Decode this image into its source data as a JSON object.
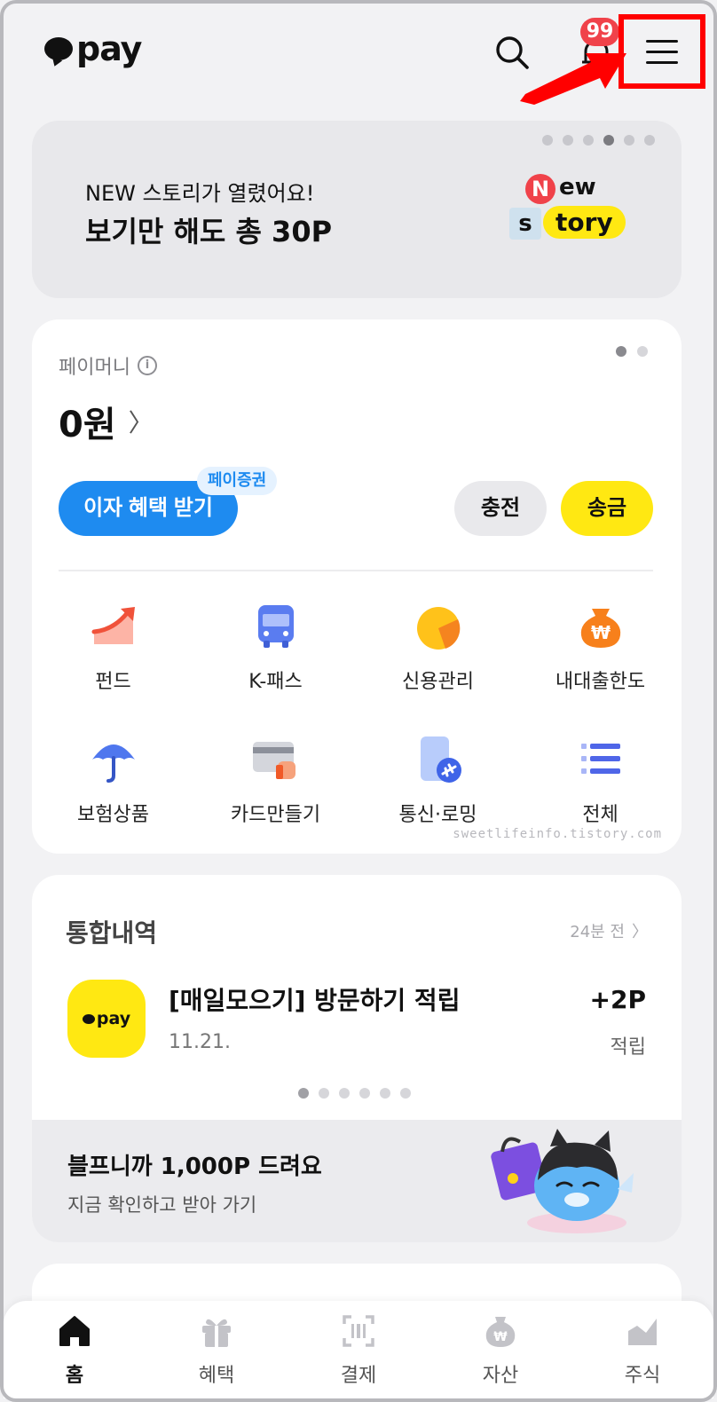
{
  "header": {
    "logo_text": "pay",
    "notification_count": "99"
  },
  "banner": {
    "subtitle": "NEW 스토리가 열렸어요!",
    "title": "보기만 해도 총 30P",
    "badge_n": "N",
    "badge_ew": "ew",
    "badge_s": "s",
    "badge_tory": "tory",
    "page_count": 6,
    "active_page": 4
  },
  "paymoney": {
    "label": "페이머니",
    "balance": "0원",
    "interest_button": "이자 혜택 받기",
    "interest_tag": "페이증권",
    "charge_button": "충전",
    "send_button": "송금",
    "page_count": 2,
    "active_page": 1
  },
  "shortcuts": [
    {
      "label": "펀드",
      "icon": "fund-icon"
    },
    {
      "label": "K-패스",
      "icon": "bus-icon"
    },
    {
      "label": "신용관리",
      "icon": "credit-icon"
    },
    {
      "label": "내대출한도",
      "icon": "loan-icon"
    },
    {
      "label": "보험상품",
      "icon": "umbrella-icon"
    },
    {
      "label": "카드만들기",
      "icon": "card-icon"
    },
    {
      "label": "통신·로밍",
      "icon": "roaming-icon"
    },
    {
      "label": "전체",
      "icon": "list-icon"
    }
  ],
  "watermark": "sweetlifeinfo.tistory.com",
  "history": {
    "title": "통합내역",
    "updated": "24분 전",
    "item": {
      "icon_text": "pay",
      "name": "[매일모으기] 방문하기 적립",
      "date": "11.21.",
      "amount": "+2P",
      "type": "적립"
    },
    "page_count": 6,
    "active_page": 1
  },
  "promo": {
    "title": "블프니까 1,000P 드려요",
    "subtitle": "지금 확인하고 받아 가기"
  },
  "nav": [
    {
      "label": "홈",
      "icon": "home-icon",
      "active": true
    },
    {
      "label": "혜택",
      "icon": "gift-icon",
      "active": false
    },
    {
      "label": "결제",
      "icon": "barcode-icon",
      "active": false
    },
    {
      "label": "자산",
      "icon": "money-bag-icon",
      "active": false
    },
    {
      "label": "주식",
      "icon": "stock-icon",
      "active": false
    }
  ],
  "colors": {
    "brand_yellow": "#ffe812",
    "accent_blue": "#1e8bf0",
    "badge_red": "#f0424a",
    "highlight_red": "#ff0000"
  }
}
